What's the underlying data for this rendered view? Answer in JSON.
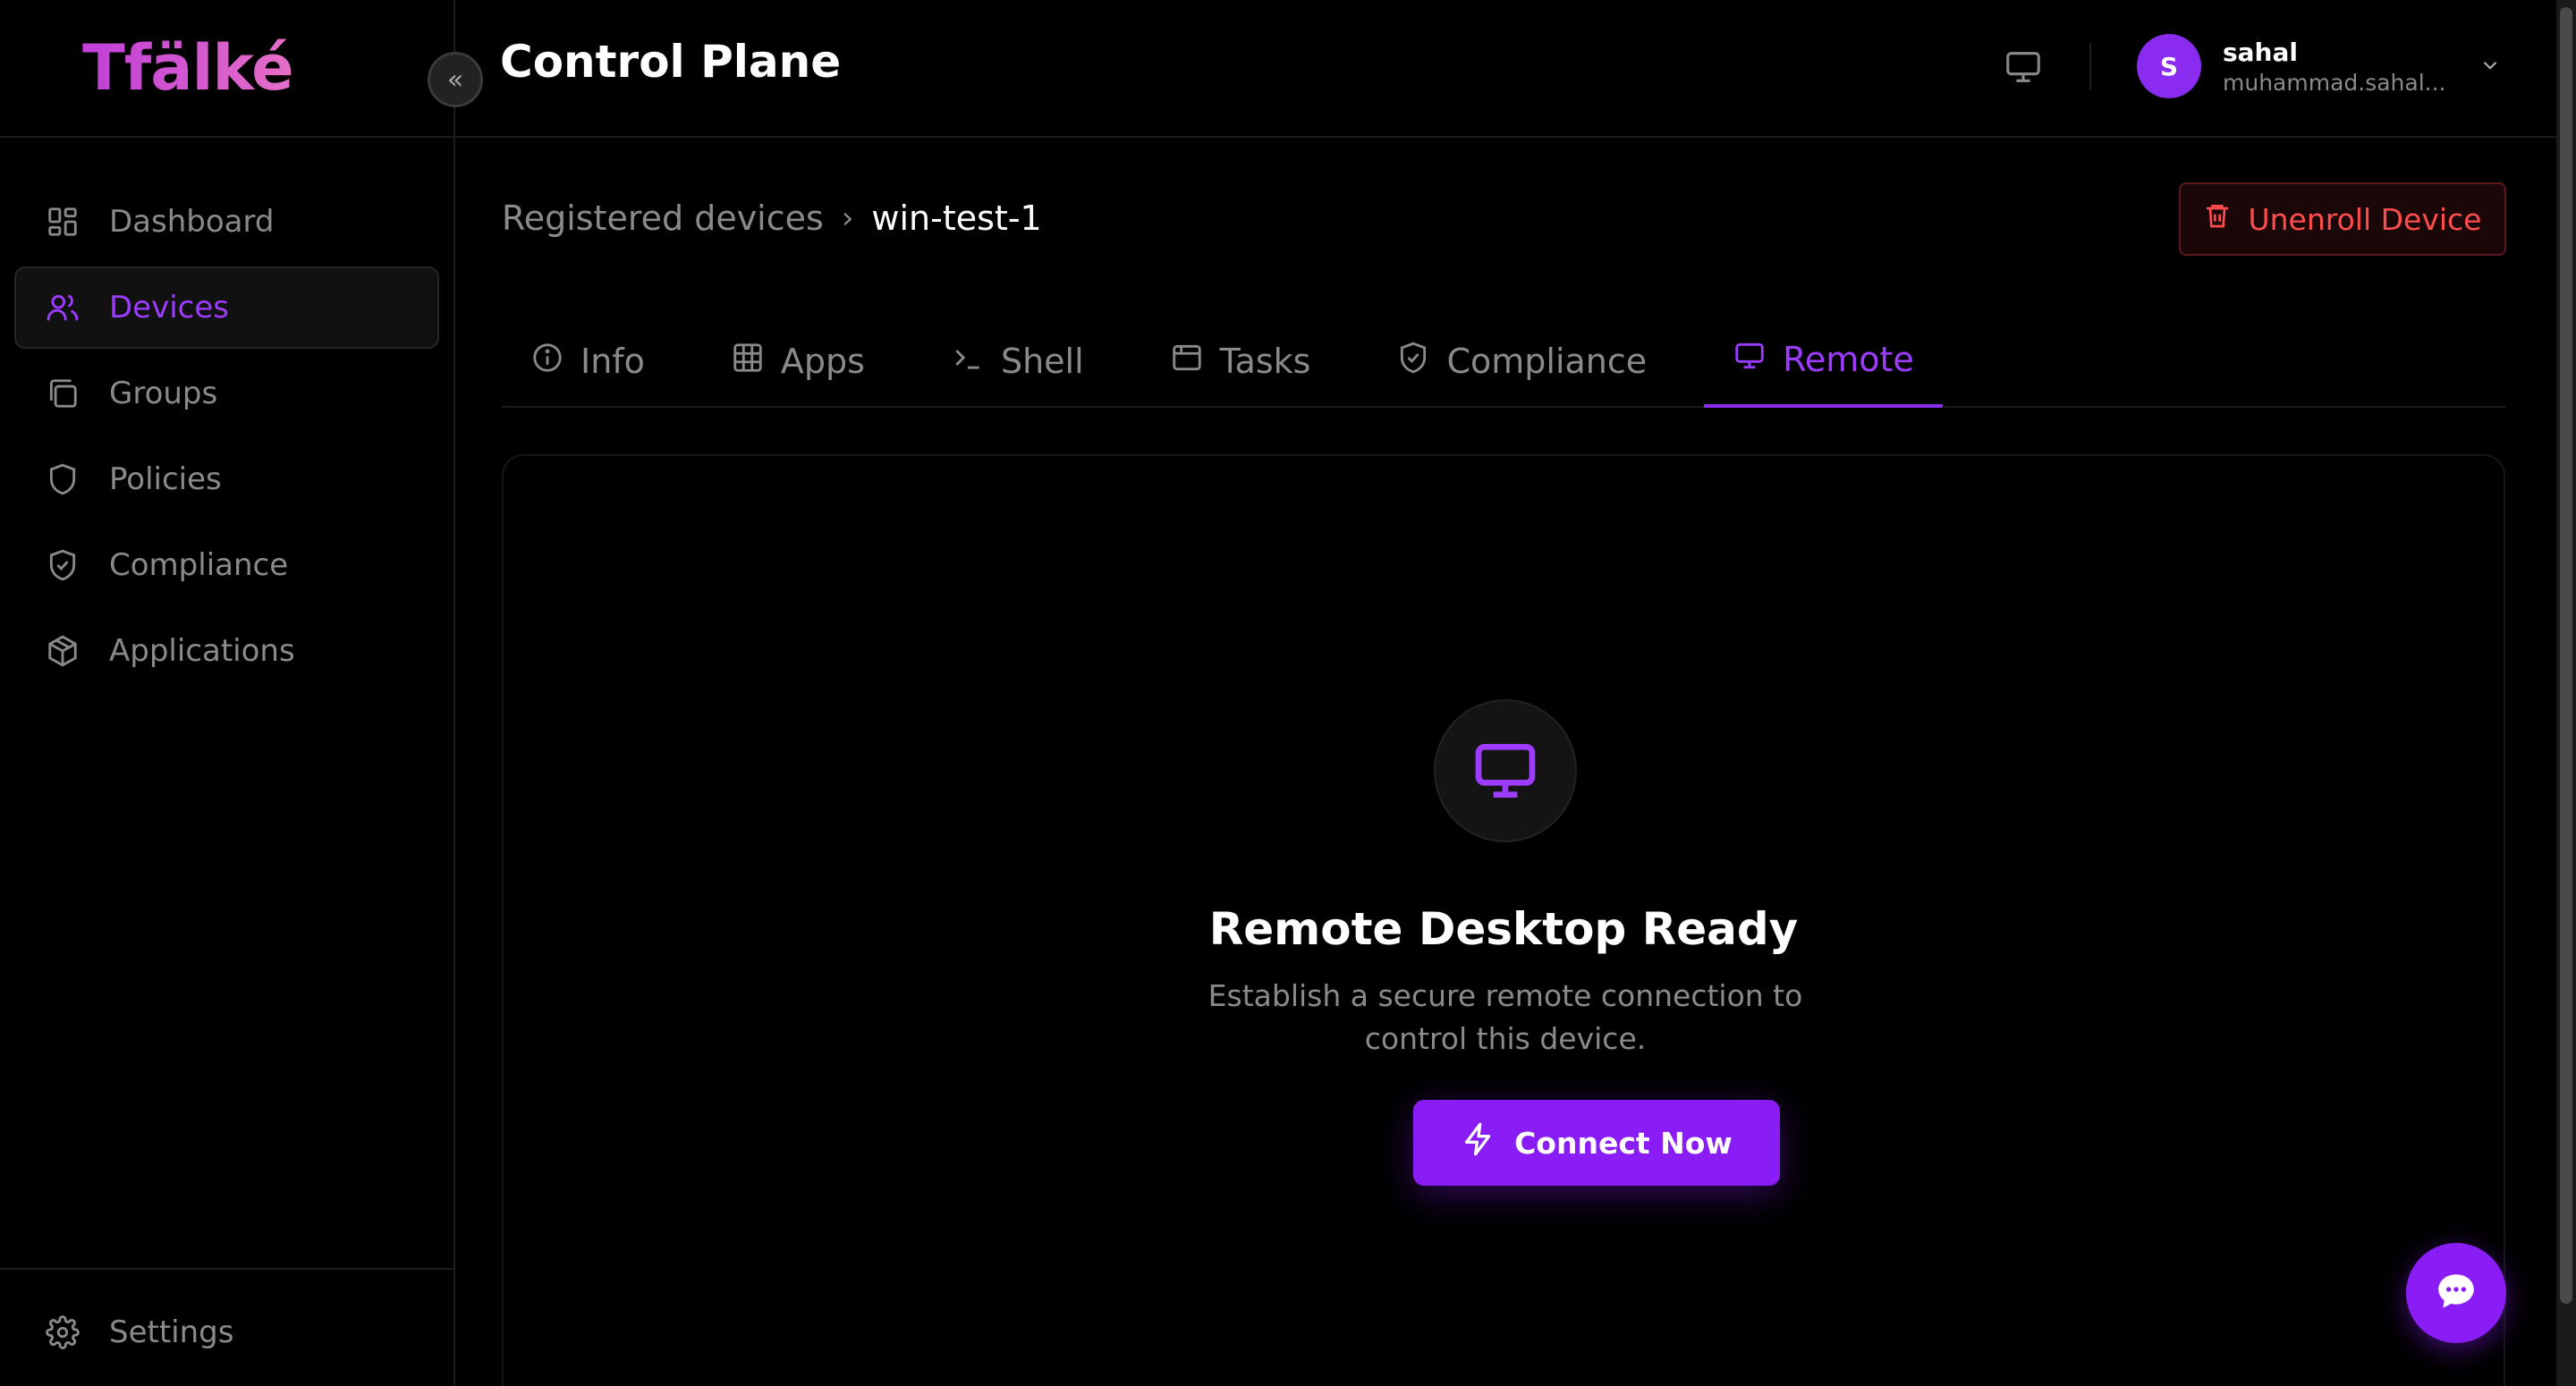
{
  "app": {
    "logo": "Tfälké",
    "title": "Control Plane"
  },
  "sidebar": {
    "items": [
      {
        "label": "Dashboard",
        "icon": "grid-icon"
      },
      {
        "label": "Devices",
        "icon": "users-icon",
        "active": true
      },
      {
        "label": "Groups",
        "icon": "layers-icon"
      },
      {
        "label": "Policies",
        "icon": "shield-icon"
      },
      {
        "label": "Compliance",
        "icon": "shield-check-icon"
      },
      {
        "label": "Applications",
        "icon": "package-icon"
      }
    ],
    "settings": {
      "label": "Settings",
      "icon": "gear-icon"
    }
  },
  "user": {
    "initial": "S",
    "name": "sahal",
    "email": "muhammad.sahal..."
  },
  "breadcrumb": {
    "parent": "Registered devices",
    "separator": "›",
    "current": "win-test-1"
  },
  "actions": {
    "unenroll": "Unenroll Device"
  },
  "tabs": [
    {
      "label": "Info",
      "icon": "info-icon"
    },
    {
      "label": "Apps",
      "icon": "grid-icon"
    },
    {
      "label": "Shell",
      "icon": "terminal-icon"
    },
    {
      "label": "Tasks",
      "icon": "calendar-icon"
    },
    {
      "label": "Compliance",
      "icon": "shield-check-icon"
    },
    {
      "label": "Remote",
      "icon": "monitor-icon",
      "active": true
    }
  ],
  "remote": {
    "title": "Remote Desktop Ready",
    "description": "Establish a secure remote connection to control this device.",
    "connect_label": "Connect Now"
  },
  "colors": {
    "accent": "#8a1cf5",
    "danger": "#ff4d4d",
    "muted": "#8a8a8a",
    "background": "#000000"
  }
}
